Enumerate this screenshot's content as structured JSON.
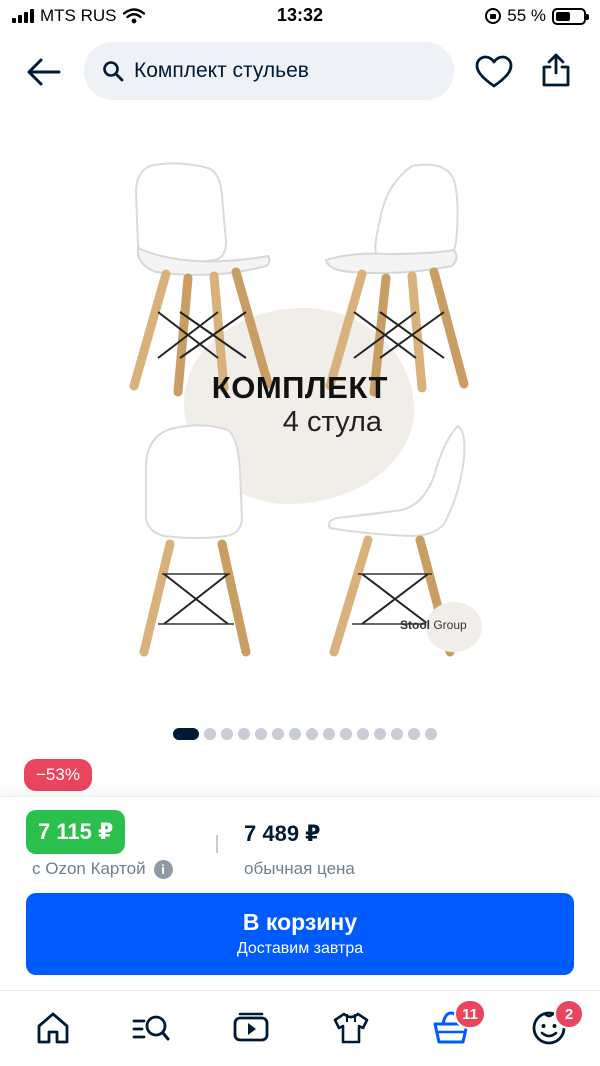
{
  "status_bar": {
    "carrier": "MTS RUS",
    "time": "13:32",
    "battery": "55 %",
    "battery_level": 0.55
  },
  "header": {
    "search_query": "Комплект стульев"
  },
  "product_image": {
    "title": "КОМПЛЕКТ",
    "subtitle": "4 стула",
    "brand_bold": "Stool",
    "brand_regular": "Group"
  },
  "carousel": {
    "total": 15,
    "active_index": 0
  },
  "discount": "−53%",
  "pricing": {
    "ozon_price": "7 115 ₽",
    "ozon_price_label": "с Ozon Картой",
    "regular_price": "7 489 ₽",
    "regular_price_label": "обычная цена"
  },
  "cart_button": {
    "label": "В корзину",
    "sublabel": "Доставим завтра"
  },
  "bottom_nav": {
    "items": [
      {
        "icon": "home-icon"
      },
      {
        "icon": "catalog-search-icon"
      },
      {
        "icon": "video-icon"
      },
      {
        "icon": "fresh-clothes-icon"
      },
      {
        "icon": "cart-icon",
        "badge": "11"
      },
      {
        "icon": "profile-icon",
        "badge": "2"
      }
    ]
  },
  "colors": {
    "accent": "#005bff",
    "ozon_card_green": "#2bc04e",
    "discount_red": "#e9455f",
    "text_primary": "#001a34",
    "text_secondary": "#707f8d"
  }
}
